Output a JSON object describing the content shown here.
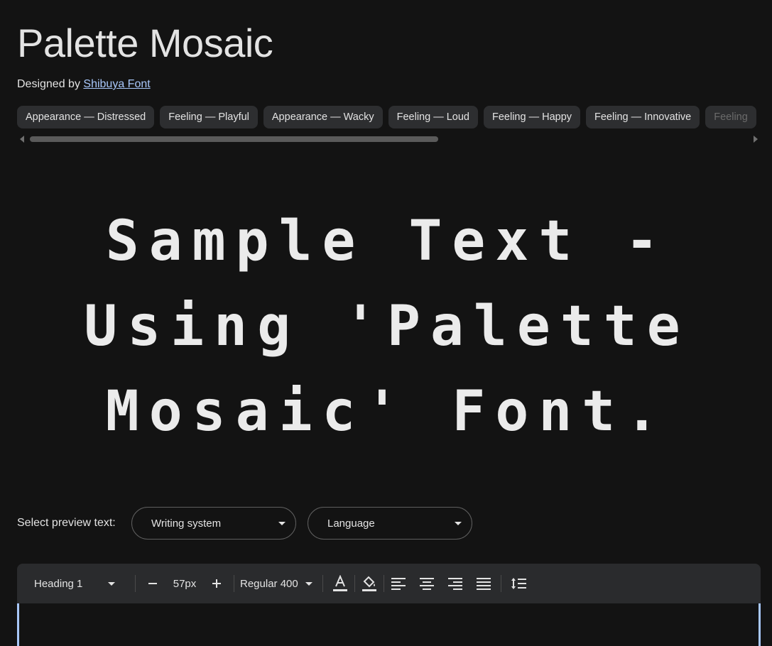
{
  "page": {
    "title": "Palette Mosaic",
    "designed_by": "Designed by",
    "designer": "Shibuya Font"
  },
  "tags": [
    "Appearance — Distressed",
    "Feeling — Playful",
    "Appearance — Wacky",
    "Feeling — Loud",
    "Feeling — Happy",
    "Feeling — Innovative",
    "Feeling"
  ],
  "sample_text": "Sample Text - Using 'Palette Mosaic' Font.",
  "preview": {
    "label": "Select preview text:",
    "writing_system": "Writing system",
    "language": "Language"
  },
  "toolbar": {
    "style": "Heading 1",
    "size": "57px",
    "weight": "Regular 400",
    "icons": [
      "text-color-icon",
      "highlight-icon",
      "align-left-icon",
      "align-center-icon",
      "align-right-icon",
      "justify-icon",
      "line-height-icon"
    ]
  },
  "colors": {
    "background": "#131313",
    "link": "#a8c7fa",
    "chip": "#2d2e30"
  }
}
